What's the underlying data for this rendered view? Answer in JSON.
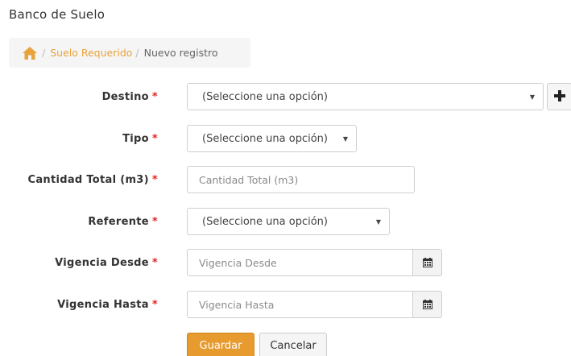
{
  "page": {
    "title": "Banco de Suelo"
  },
  "breadcrumb": {
    "separator": "/",
    "items": [
      {
        "label": "Suelo Requerido"
      },
      {
        "label": "Nuevo registro"
      }
    ]
  },
  "form": {
    "required_mark": "*",
    "destino": {
      "label": "Destino",
      "value": "(Seleccione una opción)"
    },
    "tipo": {
      "label": "Tipo",
      "value": "(Seleccione una opción)"
    },
    "cantidad": {
      "label": "Cantidad Total (m3)",
      "placeholder": "Cantidad Total (m3)"
    },
    "referente": {
      "label": "Referente",
      "value": "(Seleccione una opción)"
    },
    "vigencia_desde": {
      "label": "Vigencia Desde",
      "placeholder": "Vigencia Desde"
    },
    "vigencia_hasta": {
      "label": "Vigencia Hasta",
      "placeholder": "Vigencia Hasta"
    }
  },
  "actions": {
    "save_label": "Guardar",
    "cancel_label": "Cancelar"
  },
  "colors": {
    "accent": "#e79a2d",
    "link": "#e8a33d",
    "required": "#e02424"
  },
  "icons": {
    "home": "home-icon",
    "add": "plus-icon",
    "calendar": "calendar-icon",
    "dropdown": "caret-down-icon"
  }
}
